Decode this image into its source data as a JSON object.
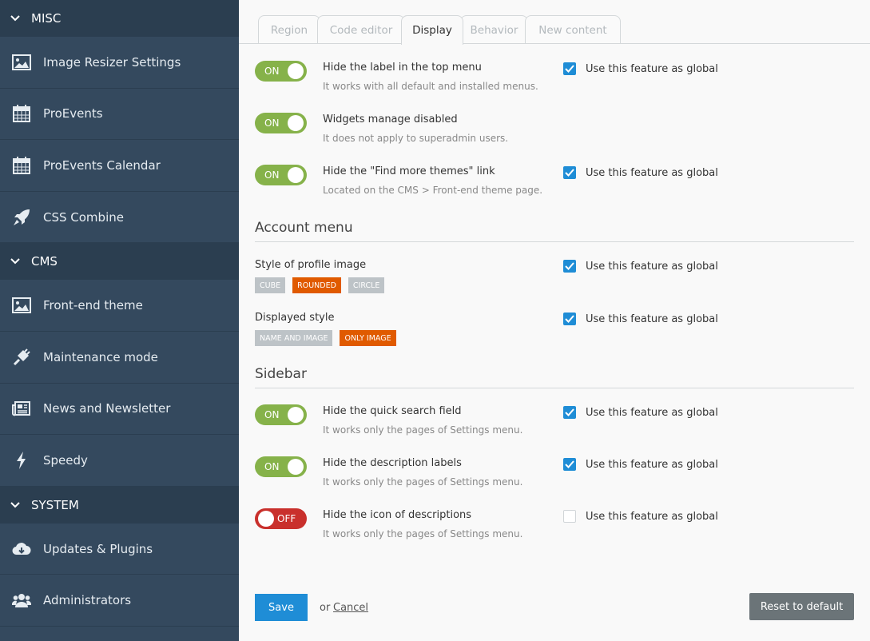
{
  "sidebar": {
    "sections": [
      {
        "title": "MISC",
        "items": [
          {
            "label": "Image Resizer Settings",
            "icon": "image-icon"
          },
          {
            "label": "ProEvents",
            "icon": "calendar-icon"
          },
          {
            "label": "ProEvents Calendar",
            "icon": "calendar-icon"
          },
          {
            "label": "CSS Combine",
            "icon": "rocket-icon"
          }
        ]
      },
      {
        "title": "CMS",
        "items": [
          {
            "label": "Front-end theme",
            "icon": "image-icon"
          },
          {
            "label": "Maintenance mode",
            "icon": "plug-icon"
          },
          {
            "label": "News and Newsletter",
            "icon": "newspaper-icon"
          },
          {
            "label": "Speedy",
            "icon": "bolt-icon"
          }
        ]
      },
      {
        "title": "SYSTEM",
        "items": [
          {
            "label": "Updates & Plugins",
            "icon": "cloud-download-icon"
          },
          {
            "label": "Administrators",
            "icon": "users-icon"
          }
        ]
      }
    ]
  },
  "tabs": [
    {
      "label": "Region",
      "active": false
    },
    {
      "label": "Code editor",
      "active": false
    },
    {
      "label": "Display",
      "active": true
    },
    {
      "label": "Behavior",
      "active": false
    },
    {
      "label": "New content",
      "active": false
    }
  ],
  "global_label": "Use this feature as global",
  "top_settings": [
    {
      "toggle": "ON",
      "label": "Hide the label in the top menu",
      "desc": "It works with all default and installed menus.",
      "global": true
    },
    {
      "toggle": "ON",
      "label": "Widgets manage disabled",
      "desc": "It does not apply to superadmin users.",
      "global": null
    },
    {
      "toggle": "ON",
      "label": "Hide the \"Find more themes\" link",
      "desc": "Located on the CMS > Front-end theme page.",
      "global": true
    }
  ],
  "account_menu": {
    "heading": "Account menu",
    "fields": [
      {
        "label": "Style of profile image",
        "options": [
          "CUBE",
          "ROUNDED",
          "CIRCLE"
        ],
        "selected": "ROUNDED",
        "global": true
      },
      {
        "label": "Displayed style",
        "options": [
          "NAME AND IMAGE",
          "ONLY IMAGE"
        ],
        "selected": "ONLY IMAGE",
        "global": true
      }
    ]
  },
  "sidebar_section": {
    "heading": "Sidebar",
    "settings": [
      {
        "toggle": "ON",
        "label": "Hide the quick search field",
        "desc": "It works only the pages of Settings menu.",
        "global": true
      },
      {
        "toggle": "ON",
        "label": "Hide the description labels",
        "desc": "It works only the pages of Settings menu.",
        "global": true
      },
      {
        "toggle": "OFF",
        "label": "Hide the icon of descriptions",
        "desc": "It works only the pages of Settings menu.",
        "global": false
      }
    ]
  },
  "footer": {
    "save_label": "Save",
    "or_text": "or",
    "cancel_label": "Cancel",
    "reset_label": "Reset to default"
  },
  "colors": {
    "sidebar_bg": "#34495e",
    "section_bg": "#2b3e50",
    "toggle_on": "#86b24a",
    "toggle_off": "#c9302c",
    "checkbox": "#1f8dd6",
    "option_selected": "#e05a00",
    "option_default": "#bdc3c7",
    "save_button": "#1f8dd6",
    "reset_button": "#6b7478"
  }
}
